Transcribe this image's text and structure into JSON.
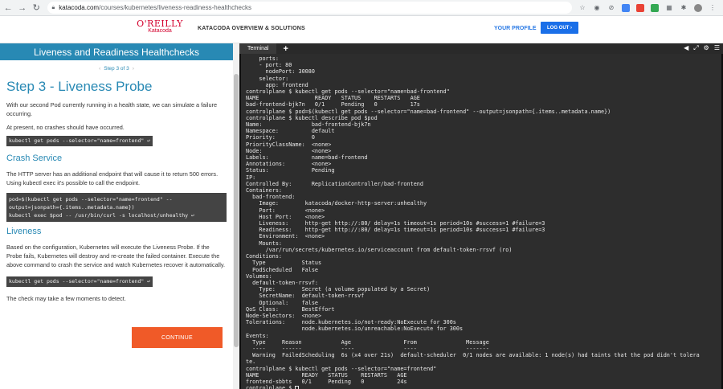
{
  "browser": {
    "url_domain": "katacoda.com",
    "url_path": "/courses/kubernetes/liveness-readiness-healthchecks"
  },
  "header": {
    "logo_top": "O'REILLY",
    "logo_bottom": "Katacoda",
    "overview_link": "KATACODA OVERVIEW & SOLUTIONS",
    "profile_link": "YOUR PROFILE",
    "logout_label": "LOG OUT"
  },
  "left": {
    "course_title": "Liveness and Readiness Healthchecks",
    "step_nav": "Step 3 of 3",
    "step_title": "Step 3 - Liveness Probe",
    "p1": "With our second Pod currently running in a health state, we can simulate a failure occurring.",
    "p2": "At present, no crashes should have occurred.",
    "code1": "kubectl get pods --selector=\"name=frontend\" ↩",
    "h_crash": "Crash Service",
    "p3": "The HTTP server has an additional endpoint that will cause it to return 500 errors. Using kubectl exec it's possible to call the endpoint.",
    "code2_l1": "pod=$(kubectl get pods --selector=\"name=frontend\" --",
    "code2_l2": "output=jsonpath={.items..metadata.name})",
    "code2_l3": "kubectl exec $pod -- /usr/bin/curl -s localhost/unhealthy ↩",
    "h_liveness": "Liveness",
    "p4": "Based on the configuration, Kubernetes will execute the Liveness Probe. If the Probe fails, Kubernetes will destroy and re-create the failed container. Execute the above command to crash the service and watch Kubernetes recover it automatically.",
    "code3": "kubectl get pods --selector=\"name=frontend\" ↩",
    "p5": "The check may take a few moments to detect.",
    "continue_label": "CONTINUE"
  },
  "terminal": {
    "tab_label": "Terminal",
    "lines": [
      "    ports:",
      "    - port: 80",
      "      nodePort: 30080",
      "    selector:",
      "      app: frontend",
      "controlplane $ kubectl get pods --selector=\"name=bad-frontend\"",
      "NAME                 READY   STATUS    RESTARTS   AGE",
      "bad-frontend-bjk7n   0/1     Pending   0          17s",
      "controlplane $ pod=$(kubectl get pods --selector=\"name=bad-frontend\" --output=jsonpath={.items..metadata.name})",
      "controlplane $ kubectl describe pod $pod",
      "Name:               bad-frontend-bjk7n",
      "Namespace:          default",
      "Priority:           0",
      "PriorityClassName:  <none>",
      "Node:               <none>",
      "Labels:             name=bad-frontend",
      "Annotations:        <none>",
      "Status:             Pending",
      "IP:",
      "Controlled By:      ReplicationController/bad-frontend",
      "Containers:",
      "  bad-frontend:",
      "    Image:        katacoda/docker-http-server:unhealthy",
      "    Port:         <none>",
      "    Host Port:    <none>",
      "    Liveness:     http-get http://:80/ delay=1s timeout=1s period=10s #success=1 #failure=3",
      "    Readiness:    http-get http://:80/ delay=1s timeout=1s period=10s #success=1 #failure=3",
      "    Environment:  <none>",
      "    Mounts:",
      "      /var/run/secrets/kubernetes.io/serviceaccount from default-token-rrsvf (ro)",
      "Conditions:",
      "  Type           Status",
      "  PodScheduled   False",
      "Volumes:",
      "  default-token-rrsvf:",
      "    Type:        Secret (a volume populated by a Secret)",
      "    SecretName:  default-token-rrsvf",
      "    Optional:    false",
      "QoS Class:       BestEffort",
      "Node-Selectors:  <none>",
      "Tolerations:     node.kubernetes.io/not-ready:NoExecute for 300s",
      "                 node.kubernetes.io/unreachable:NoExecute for 300s",
      "Events:",
      "  Type     Reason            Age                From               Message",
      "  ----     ------            ----               ----               -------",
      "  Warning  FailedScheduling  6s (x4 over 21s)  default-scheduler  0/1 nodes are available: 1 node(s) had taints that the pod didn't tolera",
      "te.",
      "controlplane $ kubectl get pods --selector=\"name=frontend\"",
      "NAME             READY   STATUS    RESTARTS   AGE",
      "frontend-sbbts   0/1     Pending   0          24s"
    ],
    "prompt": "controlplane $ "
  }
}
